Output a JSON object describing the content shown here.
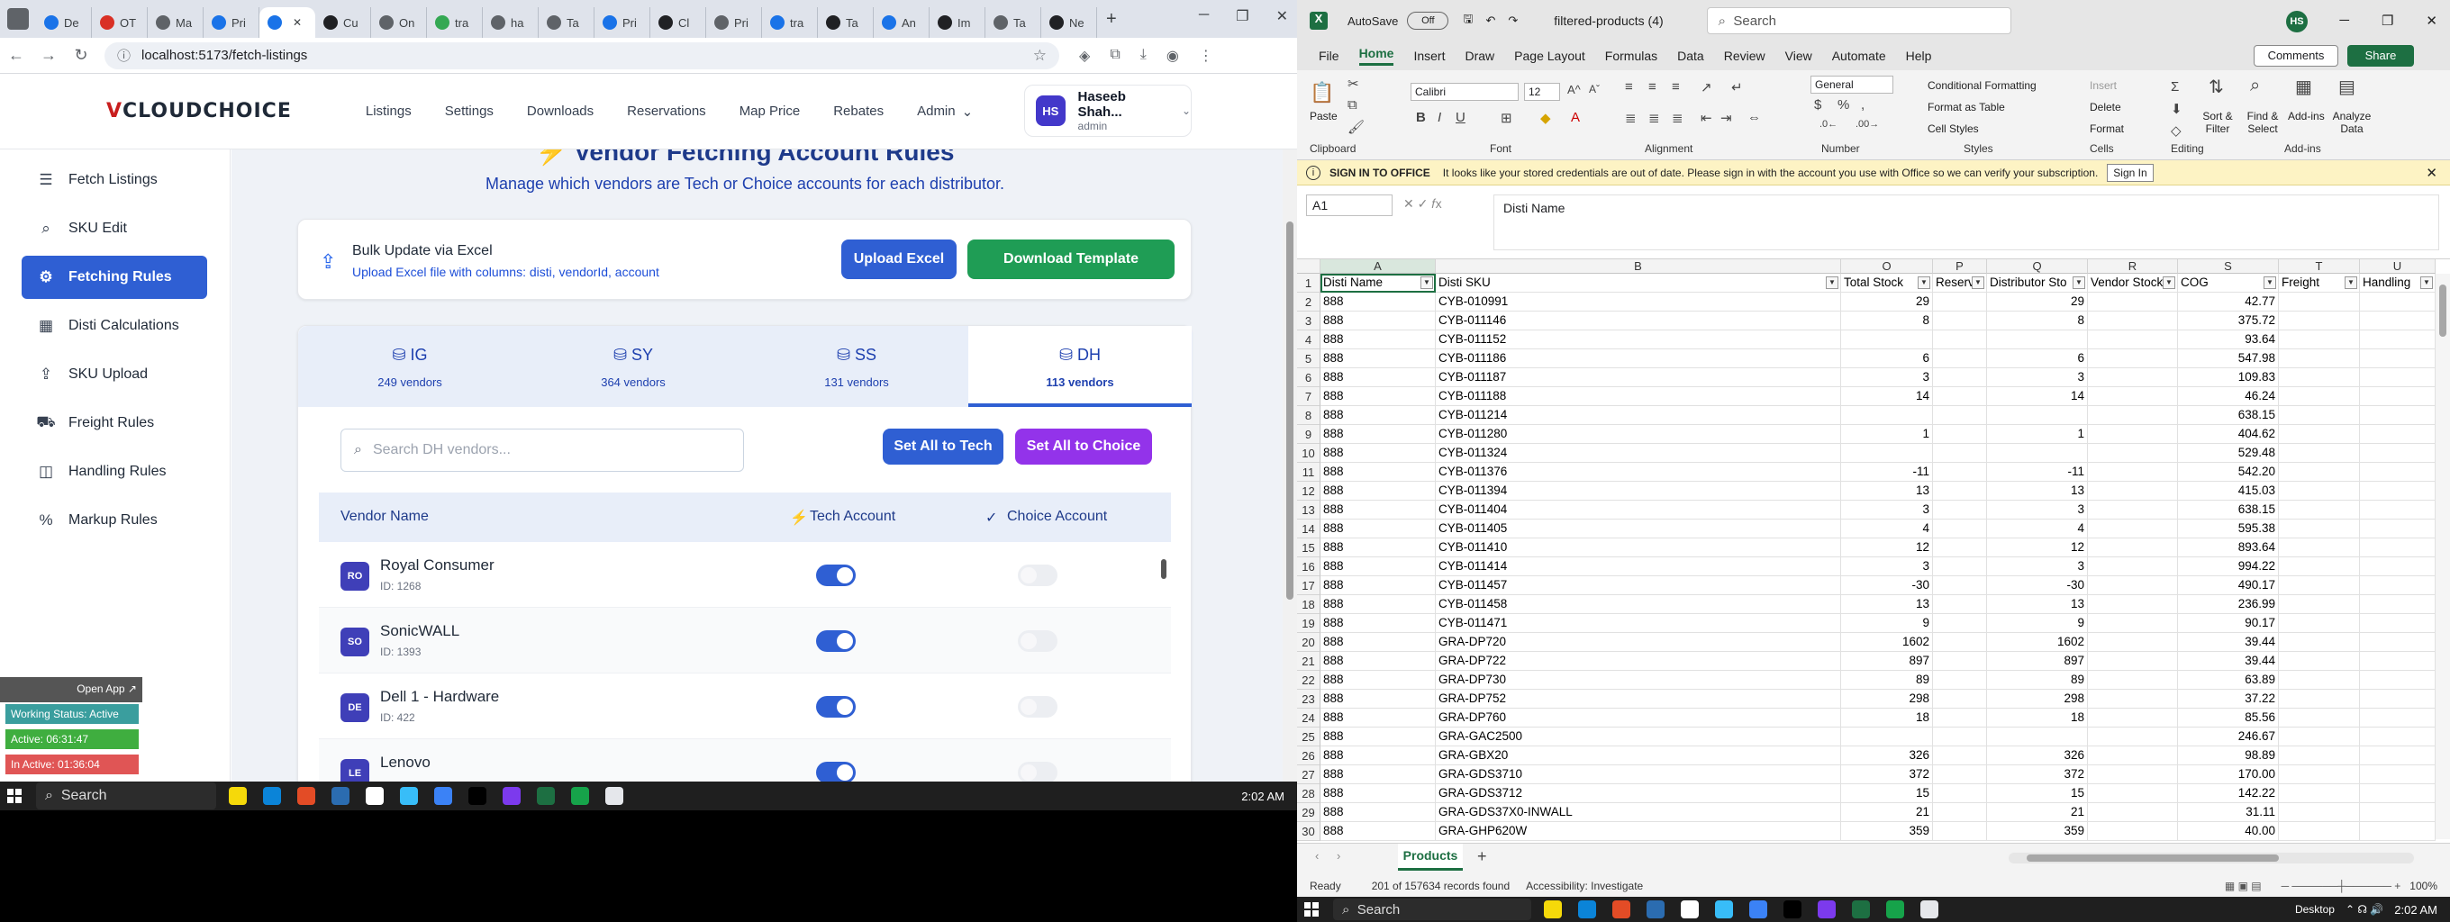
{
  "browser": {
    "tabs": [
      {
        "label": "De",
        "color": "#1a73e8"
      },
      {
        "label": "OT",
        "color": "#d93025"
      },
      {
        "label": "Ma",
        "color": "#5f6368"
      },
      {
        "label": "Pri",
        "color": "#1a73e8"
      },
      {
        "label": "",
        "color": "#1a73e8",
        "active": true
      },
      {
        "label": "Cu",
        "color": "#202124"
      },
      {
        "label": "On",
        "color": "#5f6368"
      },
      {
        "label": "tra",
        "color": "#34a853"
      },
      {
        "label": "ha",
        "color": "#5f6368"
      },
      {
        "label": "Ta",
        "color": "#5f6368"
      },
      {
        "label": "Pri",
        "color": "#1a73e8"
      },
      {
        "label": "Cl",
        "color": "#202124"
      },
      {
        "label": "Pri",
        "color": "#5f6368"
      },
      {
        "label": "tra",
        "color": "#1a73e8"
      },
      {
        "label": "Ta",
        "color": "#202124"
      },
      {
        "label": "An",
        "color": "#1a73e8"
      },
      {
        "label": "Im",
        "color": "#202124"
      },
      {
        "label": "Ta",
        "color": "#5f6368"
      },
      {
        "label": "Ne",
        "color": "#202124"
      }
    ],
    "url": "localhost:5173/fetch-listings"
  },
  "app": {
    "logo": {
      "mark": "V",
      "text": "CLOUDCHOICE"
    },
    "nav": [
      "Listings",
      "Settings",
      "Downloads",
      "Reservations",
      "Map Price",
      "Rebates",
      "Admin"
    ],
    "user": {
      "initials": "HS",
      "name": "Haseeb Shah...",
      "role": "admin"
    },
    "sidebar": [
      {
        "label": "Fetch Listings",
        "icon": "list-icon",
        "glyph": "☰"
      },
      {
        "label": "SKU Edit",
        "icon": "search-icon",
        "glyph": "⌕"
      },
      {
        "label": "Fetching Rules",
        "icon": "gear-icon",
        "glyph": "⚙",
        "active": true
      },
      {
        "label": "Disti Calculations",
        "icon": "calculator-icon",
        "glyph": "▦"
      },
      {
        "label": "SKU Upload",
        "icon": "upload-icon",
        "glyph": "⇪"
      },
      {
        "label": "Freight Rules",
        "icon": "truck-icon",
        "glyph": "⛟"
      },
      {
        "label": "Handling Rules",
        "icon": "box-icon",
        "glyph": "◫"
      },
      {
        "label": "Markup Rules",
        "icon": "percent-icon",
        "glyph": "%"
      }
    ],
    "page_title": "Vendor Fetching Account Rules",
    "page_subtitle": "Manage which vendors are Tech or Choice accounts for each distributor.",
    "bulk": {
      "title": "Bulk Update via Excel",
      "desc": "Upload Excel file with columns: disti, vendorId, account",
      "upload_label": "Upload Excel",
      "download_label": "Download Template"
    },
    "disti_tabs": [
      {
        "name": "IG",
        "count": "249 vendors"
      },
      {
        "name": "SY",
        "count": "364 vendors"
      },
      {
        "name": "SS",
        "count": "131 vendors"
      },
      {
        "name": "DH",
        "count": "113 vendors",
        "active": true
      }
    ],
    "search_placeholder": "Search DH vendors...",
    "set_all_tech": "Set All to Tech",
    "set_all_choice": "Set All to Choice",
    "table_headers": {
      "vendor": "Vendor Name",
      "tech": "Tech Account",
      "choice": "Choice Account"
    },
    "vendors": [
      {
        "abbr": "RO",
        "name": "Royal Consumer",
        "id": "ID: 1268",
        "tech": true,
        "choice": false
      },
      {
        "abbr": "SO",
        "name": "SonicWALL",
        "id": "ID: 1393",
        "tech": true,
        "choice": false
      },
      {
        "abbr": "DE",
        "name": "Dell 1 - Hardware",
        "id": "ID: 422",
        "tech": true,
        "choice": false
      },
      {
        "abbr": "LE",
        "name": "Lenovo",
        "id": "",
        "tech": true,
        "choice": false
      }
    ]
  },
  "tracker": {
    "open_app": "Open App ↗",
    "status": "Working Status: Active",
    "active": "Active: 06:31:47",
    "inactive": "In Active: 01:36:04"
  },
  "taskbar_left": {
    "search": "Search",
    "time": "2:02 AM"
  },
  "excel": {
    "autosave": "AutoSave",
    "autosave_state": "Off",
    "file": "filtered-products (4)",
    "search": "Search",
    "user_initials": "HS",
    "menu": [
      "File",
      "Home",
      "Insert",
      "Draw",
      "Page Layout",
      "Formulas",
      "Data",
      "Review",
      "View",
      "Automate",
      "Help"
    ],
    "comments": "Comments",
    "share": "Share",
    "ribbon": {
      "paste": "Paste",
      "font_name": "Calibri",
      "font_size": "12",
      "number_format": "General",
      "cond_format": "Conditional Formatting",
      "format_table": "Format as Table",
      "cell_styles": "Cell Styles",
      "insert": "Insert",
      "delete": "Delete",
      "format": "Format",
      "sort": "Sort & Filter",
      "find": "Find & Select",
      "addins": "Add-ins",
      "analyze": "Analyze Data",
      "groups": [
        "Clipboard",
        "Font",
        "Alignment",
        "Number",
        "Styles",
        "Cells",
        "Editing",
        "Add-ins"
      ]
    },
    "infobar": {
      "title": "SIGN IN TO OFFICE",
      "msg": "It looks like your stored credentials are out of date. Please sign in with the account you use with Office so we can verify your subscription.",
      "button": "Sign In"
    },
    "namebox": "A1",
    "formula": "Disti Name",
    "columns": [
      "A",
      "B",
      "O",
      "P",
      "Q",
      "R",
      "S",
      "T",
      "U"
    ],
    "headers": [
      "Disti Name",
      "Disti SKU",
      "Total Stock",
      "Reserv",
      "Distributor Sto",
      "Vendor Stock",
      "COG",
      "Freight",
      "Handling"
    ],
    "rows": [
      [
        "888",
        "CYB-010991",
        "29",
        "",
        "29",
        "",
        "42.77"
      ],
      [
        "888",
        "CYB-011146",
        "8",
        "",
        "8",
        "",
        "375.72"
      ],
      [
        "888",
        "CYB-011152",
        "",
        "",
        "",
        "",
        "93.64"
      ],
      [
        "888",
        "CYB-011186",
        "6",
        "",
        "6",
        "",
        "547.98"
      ],
      [
        "888",
        "CYB-011187",
        "3",
        "",
        "3",
        "",
        "109.83"
      ],
      [
        "888",
        "CYB-011188",
        "14",
        "",
        "14",
        "",
        "46.24"
      ],
      [
        "888",
        "CYB-011214",
        "",
        "",
        "",
        "",
        "638.15"
      ],
      [
        "888",
        "CYB-011280",
        "1",
        "",
        "1",
        "",
        "404.62"
      ],
      [
        "888",
        "CYB-011324",
        "",
        "",
        "",
        "",
        "529.48"
      ],
      [
        "888",
        "CYB-011376",
        "-11",
        "",
        "-11",
        "",
        "542.20"
      ],
      [
        "888",
        "CYB-011394",
        "13",
        "",
        "13",
        "",
        "415.03"
      ],
      [
        "888",
        "CYB-011404",
        "3",
        "",
        "3",
        "",
        "638.15"
      ],
      [
        "888",
        "CYB-011405",
        "4",
        "",
        "4",
        "",
        "595.38"
      ],
      [
        "888",
        "CYB-011410",
        "12",
        "",
        "12",
        "",
        "893.64"
      ],
      [
        "888",
        "CYB-011414",
        "3",
        "",
        "3",
        "",
        "994.22"
      ],
      [
        "888",
        "CYB-011457",
        "-30",
        "",
        "-30",
        "",
        "490.17"
      ],
      [
        "888",
        "CYB-011458",
        "13",
        "",
        "13",
        "",
        "236.99"
      ],
      [
        "888",
        "CYB-011471",
        "9",
        "",
        "9",
        "",
        "90.17"
      ],
      [
        "888",
        "GRA-DP720",
        "1602",
        "",
        "1602",
        "",
        "39.44"
      ],
      [
        "888",
        "GRA-DP722",
        "897",
        "",
        "897",
        "",
        "39.44"
      ],
      [
        "888",
        "GRA-DP730",
        "89",
        "",
        "89",
        "",
        "63.89"
      ],
      [
        "888",
        "GRA-DP752",
        "298",
        "",
        "298",
        "",
        "37.22"
      ],
      [
        "888",
        "GRA-DP760",
        "18",
        "",
        "18",
        "",
        "85.56"
      ],
      [
        "888",
        "GRA-GAC2500",
        "",
        "",
        "",
        "",
        "246.67"
      ],
      [
        "888",
        "GRA-GBX20",
        "326",
        "",
        "326",
        "",
        "98.89"
      ],
      [
        "888",
        "GRA-GDS3710",
        "372",
        "",
        "372",
        "",
        "170.00"
      ],
      [
        "888",
        "GRA-GDS3712",
        "15",
        "",
        "15",
        "",
        "142.22"
      ],
      [
        "888",
        "GRA-GDS37X0-INWALL",
        "21",
        "",
        "21",
        "",
        "31.11"
      ],
      [
        "888",
        "GRA-GHP620W",
        "359",
        "",
        "359",
        "",
        "40.00"
      ]
    ],
    "sheet": "Products",
    "status_ready": "Ready",
    "status_records": "201 of 157634 records found",
    "status_access": "Accessibility: Investigate",
    "zoom": "100%"
  },
  "taskbar_right": {
    "search": "Search",
    "desktop": "Desktop",
    "time": "2:02 AM"
  },
  "taskbar_apps": [
    "#f5d90a",
    "#0b84d8",
    "#e34c26",
    "#2b6cb0",
    "#ffffff",
    "#38bdf8",
    "#3b82f6",
    "#000000",
    "#7c3aed",
    "#1d6f42",
    "#16a34a",
    "#e5e7eb"
  ]
}
